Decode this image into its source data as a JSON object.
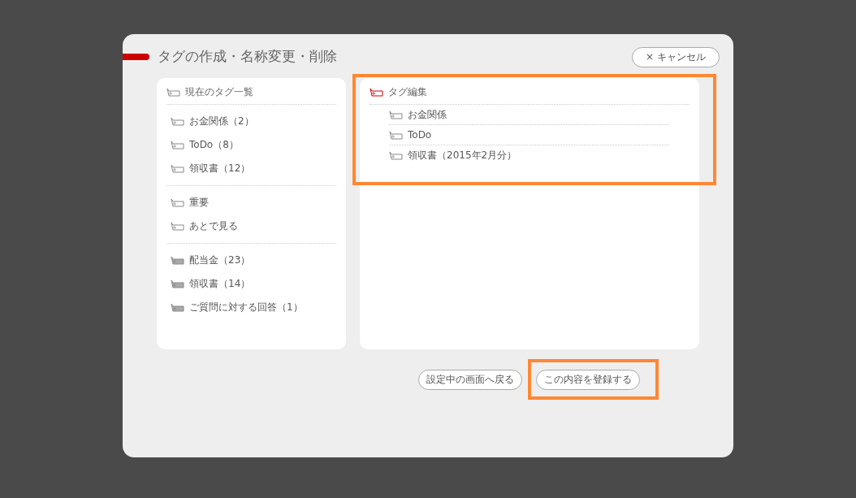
{
  "dialog": {
    "title": "タグの作成・名称変更・削除",
    "cancel_button": "× キャンセル"
  },
  "tag_list": {
    "title": "現在のタグ一覧",
    "groups": [
      [
        {
          "label": "お金関係（2）",
          "kind": "outline"
        },
        {
          "label": "ToDo（8）",
          "kind": "outline"
        },
        {
          "label": "領収書（12）",
          "kind": "outline"
        }
      ],
      [
        {
          "label": "重要",
          "kind": "outline"
        },
        {
          "label": "あとで見る",
          "kind": "outline"
        }
      ],
      [
        {
          "label": "配当金（23）",
          "kind": "filled"
        },
        {
          "label": "領収書（14）",
          "kind": "filled"
        },
        {
          "label": "ご質問に対する回答（1）",
          "kind": "filled"
        }
      ]
    ]
  },
  "tag_edit": {
    "title": "タグ編集",
    "highlighted": true,
    "items": [
      {
        "label": "お金関係"
      },
      {
        "label": "ToDo"
      },
      {
        "label": "領収書（2015年2月分）"
      }
    ]
  },
  "buttons": [
    {
      "label": "設定中の画面へ戻る",
      "highlighted": false
    },
    {
      "label": "この内容を登録する",
      "highlighted": true
    }
  ]
}
